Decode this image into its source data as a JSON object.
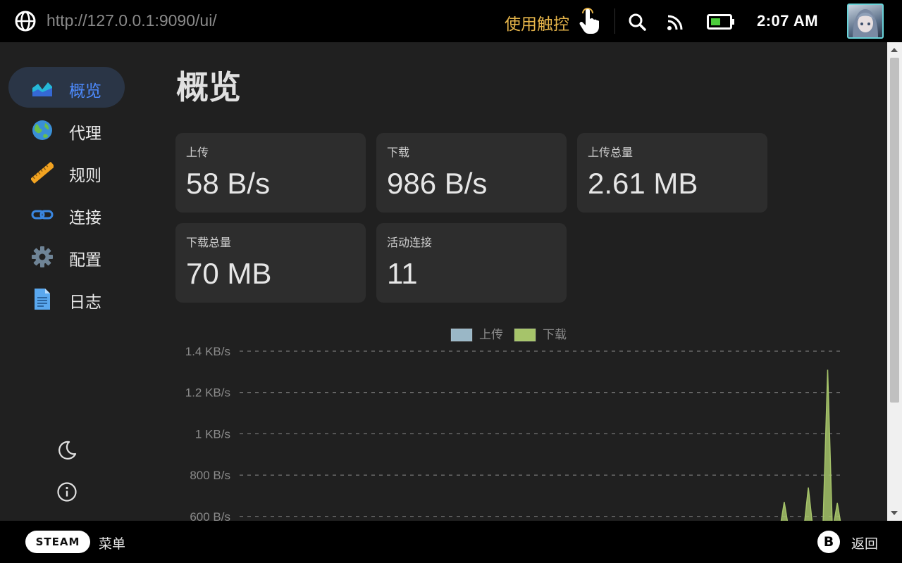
{
  "topbar": {
    "url": "http://127.0.0.1:9090/ui/",
    "touch_label": "使用触控",
    "time": "2:07 AM",
    "icons": [
      "globe-icon",
      "touch-hand-icon",
      "search-icon",
      "rss-icon",
      "battery-icon",
      "avatar"
    ]
  },
  "sidebar": {
    "items": [
      {
        "label": "概览",
        "icon": "overview-chart-icon",
        "active": true
      },
      {
        "label": "代理",
        "icon": "globe-earth-icon",
        "active": false
      },
      {
        "label": "规则",
        "icon": "ruler-icon",
        "active": false
      },
      {
        "label": "连接",
        "icon": "link-icon",
        "active": false
      },
      {
        "label": "配置",
        "icon": "gear-icon",
        "active": false
      },
      {
        "label": "日志",
        "icon": "document-icon",
        "active": false
      }
    ]
  },
  "main": {
    "title": "概览",
    "cards": [
      {
        "label": "上传",
        "value": "58 B/s"
      },
      {
        "label": "下载",
        "value": "986 B/s"
      },
      {
        "label": "上传总量",
        "value": "2.61 MB"
      },
      {
        "label": "下载总量",
        "value": "70 MB"
      },
      {
        "label": "活动连接",
        "value": "11"
      }
    ]
  },
  "colors": {
    "upload": "#9ab7c6",
    "download": "#a6c46a",
    "active_nav": "#4d8bff",
    "touch": "#e6b54a"
  },
  "chart_data": {
    "type": "area",
    "legend": [
      "上传",
      "下载"
    ],
    "legend_position": "top-center",
    "y_ticks": [
      "1.4 KB/s",
      "1.2 KB/s",
      "1 KB/s",
      "800 B/s",
      "600 B/s"
    ],
    "ylim": [
      600,
      1400
    ],
    "grid": true,
    "series": [
      {
        "name": "下载",
        "values": [
          0,
          0,
          0,
          0,
          0,
          0,
          0,
          0,
          0,
          0,
          0,
          0,
          0,
          0,
          0,
          0,
          0,
          0,
          0,
          0,
          0,
          0,
          0,
          0,
          0,
          0,
          0,
          0,
          0,
          0,
          0,
          0,
          0,
          0,
          0,
          0,
          0,
          0,
          0,
          0,
          0,
          0,
          0,
          0,
          0,
          0,
          0,
          0,
          0,
          0,
          0,
          0,
          0,
          0,
          0,
          0,
          0,
          0,
          0,
          0,
          0,
          0,
          0,
          0,
          0,
          0,
          0,
          0,
          0,
          0,
          0,
          0,
          0,
          0,
          0,
          0,
          0,
          0,
          0,
          0,
          0,
          0,
          0,
          0,
          0,
          0,
          0,
          0,
          0,
          0,
          0,
          0,
          0,
          0,
          0,
          0,
          0,
          0,
          0,
          0,
          0,
          0,
          0,
          0,
          0,
          0,
          0,
          0,
          0,
          0,
          0,
          0,
          0,
          670,
          0,
          0,
          0,
          0,
          740,
          0,
          0,
          0,
          1310,
          0,
          665,
          0
        ]
      },
      {
        "name": "上传",
        "values": []
      }
    ]
  },
  "bottombar": {
    "steam_label": "STEAM",
    "menu_label": "菜单",
    "b_label": "B",
    "back_label": "返回"
  }
}
